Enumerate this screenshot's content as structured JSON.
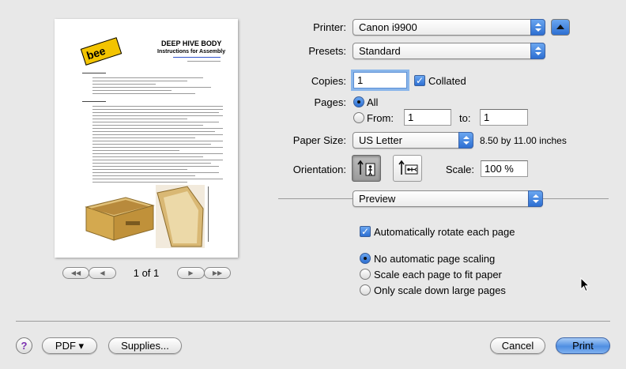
{
  "printer": {
    "label": "Printer:",
    "value": "Canon i9900"
  },
  "presets": {
    "label": "Presets:",
    "value": "Standard"
  },
  "copies": {
    "label": "Copies:",
    "value": "1",
    "collated_label": "Collated",
    "collated": true
  },
  "pages": {
    "label": "Pages:",
    "all_label": "All",
    "from_label": "From:",
    "from_value": "1",
    "to_label": "to:",
    "to_value": "1"
  },
  "paper_size": {
    "label": "Paper Size:",
    "value": "US Letter",
    "dimensions": "8.50 by 11.00 inches"
  },
  "orientation": {
    "label": "Orientation:"
  },
  "scale": {
    "label": "Scale:",
    "value": "100 %"
  },
  "section_popup": {
    "value": "Preview"
  },
  "preview_options": {
    "auto_rotate_label": "Automatically rotate each page",
    "auto_rotate": true,
    "scaling_options": [
      {
        "label": "No automatic page scaling",
        "selected": true
      },
      {
        "label": "Scale each page to fit paper",
        "selected": false
      },
      {
        "label": "Only scale down large pages",
        "selected": false
      }
    ]
  },
  "preview_page": {
    "title": "DEEP HIVE BODY",
    "subtitle": "Instructions for Assembly",
    "logo_text": "bee",
    "page_counter": "1 of 1"
  },
  "footer": {
    "help_label": "?",
    "pdf_label": "PDF ▾",
    "supplies_label": "Supplies...",
    "cancel_label": "Cancel",
    "print_label": "Print"
  },
  "colors": {
    "accent": "#3d7fe0",
    "background": "#e8e8e8"
  }
}
